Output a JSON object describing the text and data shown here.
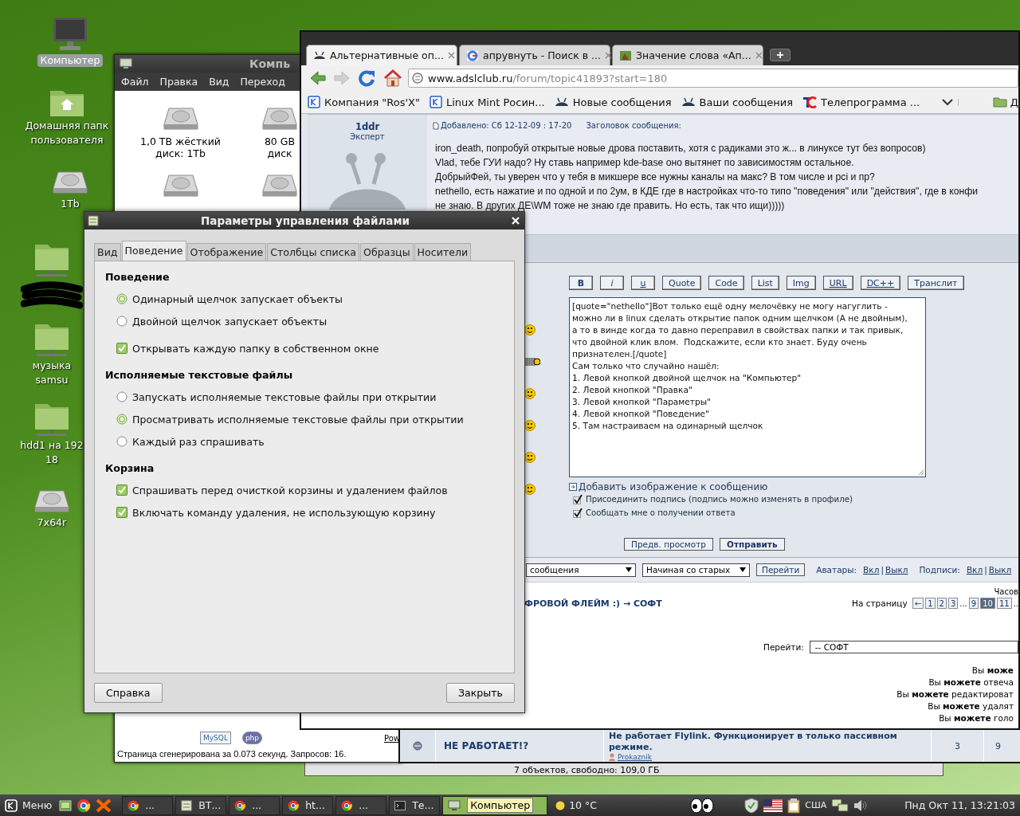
{
  "desktop_icons": [
    {
      "kind": "computer",
      "lines": [
        "Компьютер"
      ],
      "selected": true
    },
    {
      "kind": "home",
      "lines": [
        "Домашняя папк",
        "пользователя"
      ],
      "selected": false
    },
    {
      "kind": "drive",
      "lines": [
        "1Tb"
      ],
      "selected": false
    },
    {
      "kind": "network",
      "selected": false,
      "redacted": true
    },
    {
      "kind": "network",
      "lines": [
        "музыка",
        "samsu"
      ],
      "selected": false
    },
    {
      "kind": "network",
      "lines": [
        "hdd1 на 192",
        "18"
      ],
      "selected": false
    },
    {
      "kind": "drive",
      "lines": [
        "7x64r"
      ],
      "selected": false
    }
  ],
  "file_manager": {
    "title": "Компь",
    "menu": [
      "Файл",
      "Правка",
      "Вид",
      "Переход"
    ],
    "items": [
      {
        "kind": "drive",
        "label": "1,0 TB жёсткий диск: 1Tb"
      },
      {
        "kind": "drive",
        "label": "80 GB диск"
      },
      {
        "kind": "drive"
      },
      {
        "kind": "drive"
      }
    ]
  },
  "web_footer": {
    "logos": [
      "MySQL",
      "php"
    ],
    "link": "Pow",
    "generated": "Страница сгенерирована за 0.073 секунд. Запросов: 16."
  },
  "file_manager_status": "7 объектов, свободно: 109,0 ГБ",
  "browser": {
    "tabs": [
      {
        "title": "Альтернативные оп...",
        "selected": true
      },
      {
        "title": "апрувнуть - Поиск в ...",
        "selected": false
      },
      {
        "title": "Значение слова «Ап...",
        "selected": false
      }
    ],
    "nav": {
      "back_disabled": false,
      "forward_disabled": true
    },
    "url": {
      "host": "www.adslclub.ru",
      "path": "/forum/topic41893?start=180"
    },
    "bookmarks": [
      {
        "kind": "site",
        "label": "Компания \"Ros'X\""
      },
      {
        "kind": "site",
        "label": "Linux Mint Росин..."
      },
      {
        "kind": "forum",
        "label": "Новые сообщения"
      },
      {
        "kind": "forum",
        "label": "Ваши сообщения"
      },
      {
        "kind": "tv",
        "label": "Телепрограмма ..."
      },
      {
        "kind": "more"
      },
      {
        "kind": "folder",
        "label": "Д"
      }
    ],
    "post": {
      "author": "1ddr",
      "rank": "Эксперт",
      "added": "Добавлено: Сб 12-12-09 : 17-20",
      "subject_label": "Заголовок сообщения:",
      "lines": [
        "iron_death, попробуй открытые новые дрова поставить, хотя с радиками это ж... в линуксе тут без вопросов)",
        "Vlad, тебе ГУИ надо? Ну ставь например kde-base оно вытянет по зависимостям остальное.",
        "ДобрыйФей, ты уверен что у тебя в микшере все нужны каналы на макс? В том числе и pci и пр?",
        "nethello, есть нажатие и по одной и по 2ум, в КДЕ где в настройках что-то типо \"поведения\" или \"действия\", где в конфи",
        "не знаю. В других ДЕ\\WM тоже не знаю где править. Но есть, так что ищи)))))"
      ]
    },
    "editor": {
      "buttons": [
        {
          "label": "B",
          "kind": "bold"
        },
        {
          "label": "i",
          "kind": "italic"
        },
        {
          "label": "u",
          "kind": "underline"
        },
        {
          "label": "Quote",
          "kind": "plain"
        },
        {
          "label": "Code",
          "kind": "plain"
        },
        {
          "label": "List",
          "kind": "plain"
        },
        {
          "label": "Img",
          "kind": "plain"
        },
        {
          "label": "URL",
          "kind": "underline"
        },
        {
          "label": "DC++",
          "kind": "underline"
        },
        {
          "label": "Транслит",
          "kind": "plain"
        }
      ],
      "text": "[quote=\"nethello\"]Вот только ещё одну мелочёвку не могу нагуглить -\nможно ли в linux сделать открытие папок одним щелчком (А не двойным),\nа то в винде когда то давно переправил в свойствах папки и так привык,\nчто двойной клик влом.  Подскажите, если кто знает. Буду очень\nпризнателен.[/quote]\nСам только что случайно нашёл:\n1. Левой кнопкой двойной щелчок на \"Компьютер\"\n2. Левой кнопкой \"Правка\"\n3. Левой кнопкой \"Параметры\"\n4. Левой кнопкой \"Поведение\"\n5. Там настраиваем на одинарный щелчок",
      "add_image": "Добавить изображение к сообщению",
      "options": [
        {
          "label": "Присоединить подпись (подпись можно изменять в профиле)",
          "checked": true
        },
        {
          "label": "Сообщать мне о получении ответа",
          "checked": true
        }
      ],
      "actions": [
        {
          "label": "Предв. просмотр",
          "kind": "secondary"
        },
        {
          "label": "Отправить",
          "kind": "primary"
        }
      ]
    },
    "view_bar": {
      "order_select": "сообщения",
      "sort_select": "Начиная со старых",
      "go": "Перейти",
      "toggles": [
        {
          "label": "Аватары:",
          "on": "Вкл",
          "separator": "|",
          "off": "Выкл"
        },
        {
          "label": "Подписи:",
          "on": "Вкл",
          "separator": "|",
          "off": "Выкл"
        }
      ]
    },
    "breadcrumb": "ФРОВОЙ ФЛЕЙМ :) → СОФТ",
    "time_label": "Часов",
    "pagination": {
      "label": "На страницу",
      "pages": [
        {
          "label": "←",
          "selected": false
        },
        {
          "label": "1",
          "selected": false
        },
        {
          "label": "2",
          "selected": false
        },
        {
          "label": "3",
          "selected": false
        },
        {
          "label": "...",
          "kind": "gap"
        },
        {
          "label": "9",
          "selected": false
        },
        {
          "label": "10",
          "selected": true
        },
        {
          "label": "11",
          "selected": false
        },
        {
          "label": "..",
          "kind": "gap"
        }
      ]
    },
    "jump": {
      "label": "Перейти:",
      "value": "-- СОФТ"
    },
    "permissions": [
      "Вы **може**",
      "Вы **можете** отвеча",
      "Вы **можете** редактироват",
      "Вы **можете** удалят",
      "Вы **можете** голо"
    ]
  },
  "lower_window": {
    "title": "НЕ РАБОТАЕТ!?",
    "subject": "Не работает Flylink. Функционирует в только пассивном режиме.",
    "author": "Prokaznik",
    "replies": "3",
    "views": "9"
  },
  "dialog": {
    "title": "Параметры управления файлами",
    "tabs": [
      {
        "label": "Вид",
        "selected": false
      },
      {
        "label": "Поведение",
        "selected": true
      },
      {
        "label": "Отображение",
        "selected": false
      },
      {
        "label": "Столбцы списка",
        "selected": false
      },
      {
        "label": "Образцы",
        "selected": false
      },
      {
        "label": "Носители",
        "selected": false
      }
    ],
    "sections": [
      {
        "heading": "Поведение",
        "options": [
          {
            "kind": "radio",
            "label": "Одинарный щелчок запускает объекты",
            "selected": true
          },
          {
            "kind": "radio",
            "label": "Двойной щелчок запускает объекты",
            "selected": false
          },
          {
            "kind": "checkbox",
            "label": "Открывать каждую папку в собственном окне",
            "checked": true
          }
        ]
      },
      {
        "heading": "Исполняемые текстовые файлы",
        "options": [
          {
            "kind": "radio",
            "label": "Запускать исполняемые текстовые файлы при открытии",
            "selected": false
          },
          {
            "kind": "radio",
            "label": "Просматривать исполняемые текстовые файлы при открытии",
            "selected": true
          },
          {
            "kind": "radio",
            "label": "Каждый раз спрашивать",
            "selected": false
          }
        ]
      },
      {
        "heading": "Корзина",
        "options": [
          {
            "kind": "checkbox",
            "label": "Спрашивать перед очисткой корзины и удалением файлов",
            "checked": true
          },
          {
            "kind": "checkbox",
            "label": "Включать команду удаления, не использующую корзину",
            "checked": true
          }
        ]
      }
    ],
    "buttons": [
      "Справка",
      "Закрыть"
    ]
  },
  "taskbar": {
    "menu": "Меню",
    "tasks": [
      {
        "kind": "browser",
        "label": "...",
        "selected": false
      },
      {
        "kind": "editor",
        "label": "ВТ...",
        "selected": false
      },
      {
        "kind": "browser",
        "label": "...",
        "selected": false
      },
      {
        "kind": "browser",
        "label": "ht...",
        "selected": false
      },
      {
        "kind": "browser",
        "label": "...",
        "selected": false
      },
      {
        "kind": "terminal",
        "label": "Те...",
        "selected": false
      },
      {
        "kind": "computer",
        "label": "Компьютер",
        "selected": true
      }
    ],
    "weather": "10 °C",
    "layout": "США",
    "clock": "Пнд Окт 11, 13:21:03"
  }
}
